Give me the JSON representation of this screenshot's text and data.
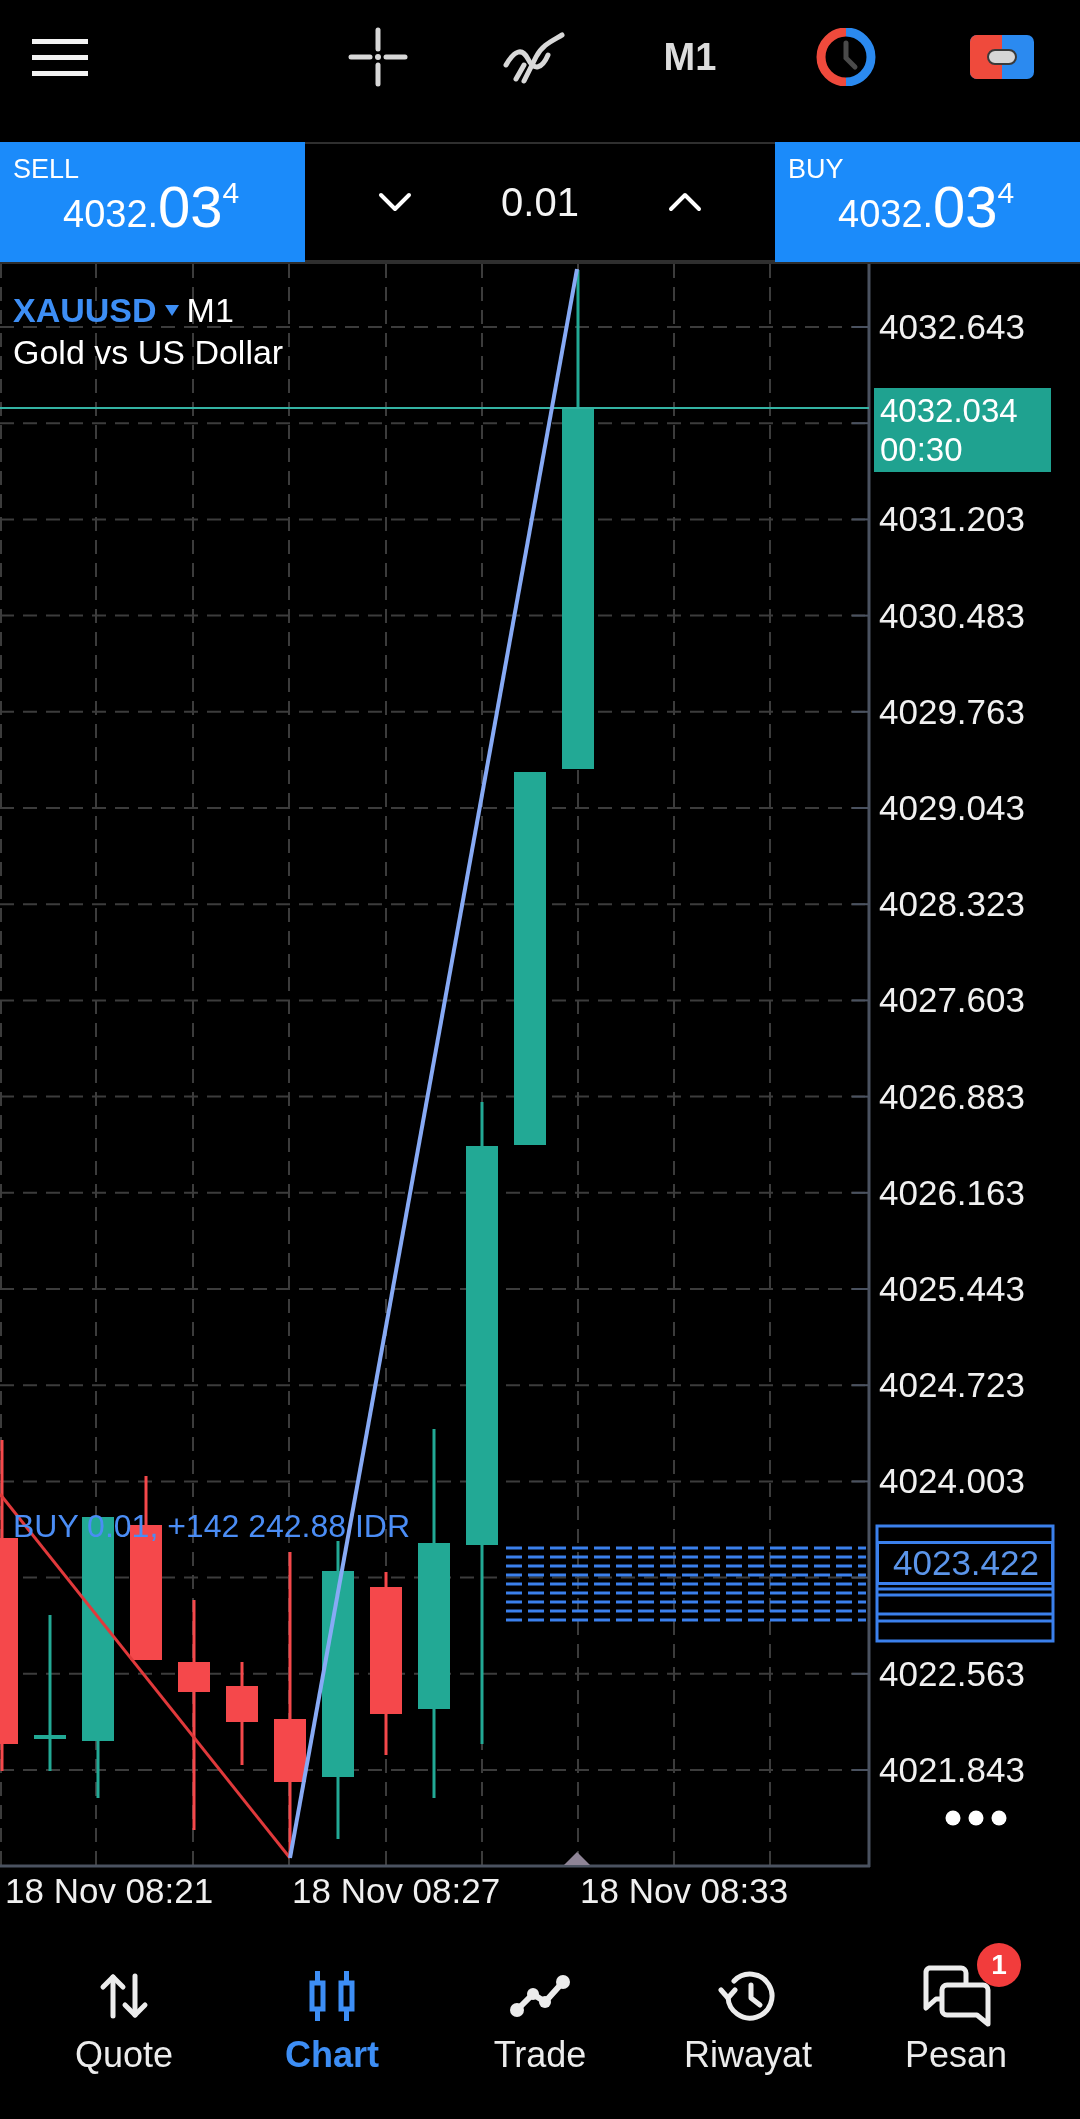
{
  "toolbar": {
    "timeframe": "M1"
  },
  "trade_bar": {
    "sell": {
      "label": "SELL",
      "price": "4032.",
      "price_large": "03",
      "price_raised": "4"
    },
    "volume": "0.01",
    "buy": {
      "label": "BUY",
      "price": "4032.",
      "price_large": "03",
      "price_raised": "4"
    }
  },
  "chart": {
    "symbol": "XAUUSD",
    "timeframe": "M1",
    "description": "Gold vs US Dollar",
    "current_price": {
      "price": "4032.034",
      "countdown": "00:30"
    },
    "order_label": "BUY 0.01, +142 242.88 IDR",
    "order_price": "4023.422",
    "price_axis": [
      "4032.643",
      "4031.203",
      "4030.483",
      "4029.763",
      "4029.043",
      "4028.323",
      "4027.603",
      "4026.883",
      "4026.163",
      "4025.443",
      "4024.723",
      "4024.003",
      "4022.563",
      "4021.843"
    ],
    "time_axis": [
      "18 Nov 08:21",
      "18 Nov 08:27",
      "18 Nov 08:33"
    ]
  },
  "nav": [
    {
      "label": "Quote",
      "selected": false
    },
    {
      "label": "Chart",
      "selected": true
    },
    {
      "label": "Trade",
      "selected": false
    },
    {
      "label": "Riwayat",
      "selected": false
    },
    {
      "label": "Pesan",
      "selected": false,
      "badge": "1"
    }
  ]
}
